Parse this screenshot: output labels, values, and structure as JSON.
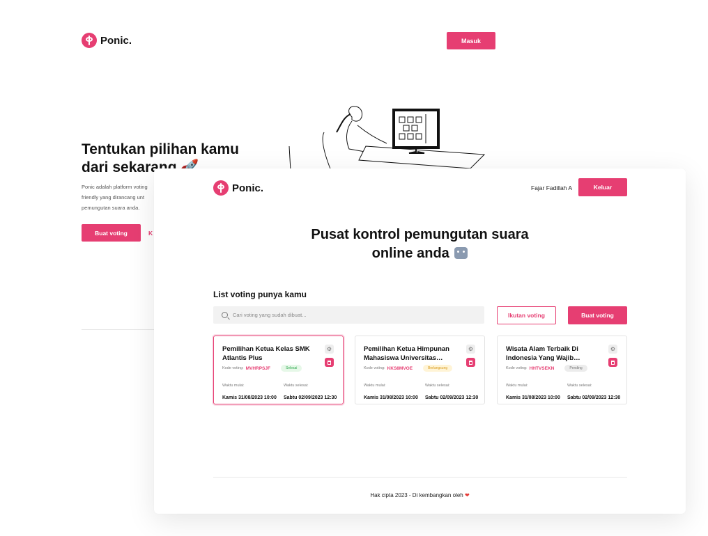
{
  "landing": {
    "brand": "Ponic.",
    "login_label": "Masuk",
    "hero_title": "Tentukan pilihan kamu dari sekarang 🚀",
    "hero_desc_lines": [
      "Ponic adalah platform voting",
      "friendly yang dirancang unt",
      "pemungutan suara anda."
    ],
    "cta_label": "Buat voting",
    "cta2_label": "K"
  },
  "app": {
    "brand": "Ponic.",
    "user_name": "Fajar Fadillah A",
    "logout_label": "Keluar",
    "heading_line1": "Pusat kontrol pemungutan suara",
    "heading_line2": "online anda",
    "list_title": "List voting punya kamu",
    "search_placeholder": "Cari voting yang sudah dibuat...",
    "follow_label": "Ikutan voting",
    "create_label": "Buat voting",
    "code_label": "Kode voting:",
    "start_label": "Waktu mulai:",
    "end_label": "Waktu selesai:",
    "cards": [
      {
        "title": "Pemilihan Ketua Kelas SMK Atlantis Plus",
        "code": "MVHRPSJF",
        "status": "Selesai",
        "start": "Kamis 31/08/2023 10:00",
        "end": "Sabtu 02/09/2023 12:30"
      },
      {
        "title": "Pemilihan Ketua Himpunan Mahasiswa Universitas Indon...",
        "code": "KKS8MVOE",
        "status": "Berlangsung",
        "start": "Kamis 31/08/2023 10:00",
        "end": "Sabtu 02/09/2023 12:30"
      },
      {
        "title": "Wisata Alam Terbaik Di Indonesia Yang Wajib Dikunju...",
        "code": "HHTVSEKN",
        "status": "Pending",
        "start": "Kamis 31/08/2023 10:00",
        "end": "Sabtu 02/09/2023 12:30"
      }
    ],
    "footer_text": "Hak cipta 2023 - Di kembangkan oleh",
    "accent_color": "#e63e72"
  }
}
